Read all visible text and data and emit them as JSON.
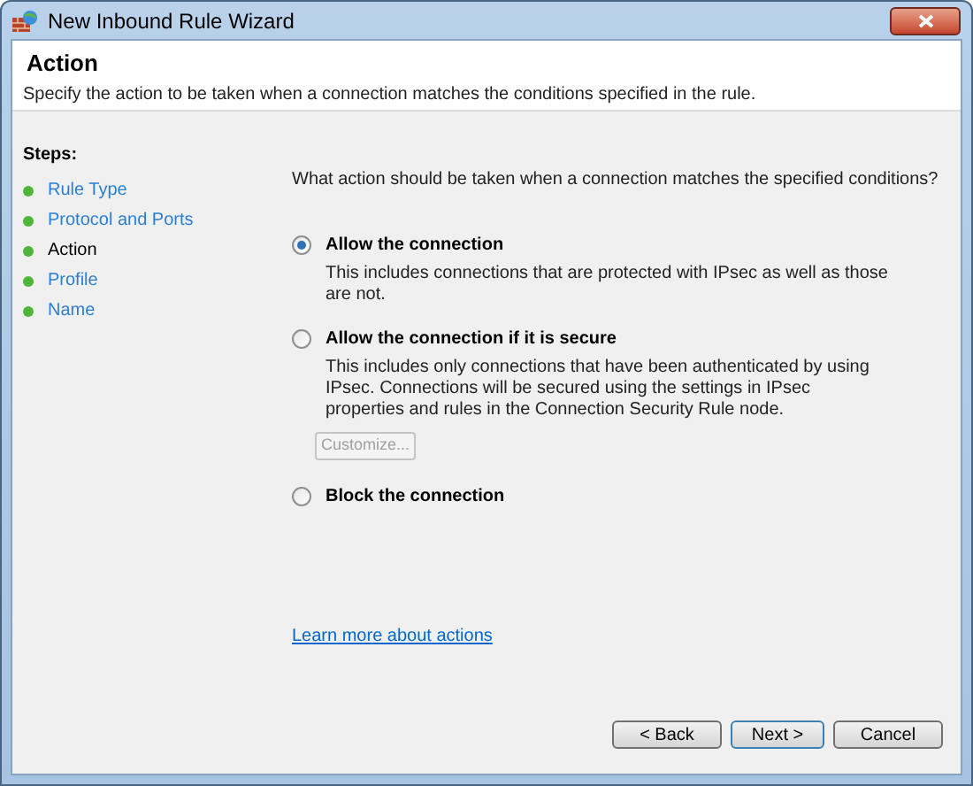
{
  "window": {
    "title": "New Inbound Rule Wizard"
  },
  "header": {
    "title": "Action",
    "description": "Specify the action to be taken when a connection matches the conditions specified in the rule."
  },
  "steps": {
    "heading": "Steps:",
    "items": [
      {
        "label": "Rule Type",
        "selected": false
      },
      {
        "label": "Protocol and Ports",
        "selected": false
      },
      {
        "label": "Action",
        "selected": true
      },
      {
        "label": "Profile",
        "selected": false
      },
      {
        "label": "Name",
        "selected": false
      }
    ]
  },
  "question": "What action should be taken when a connection matches the specified conditions?",
  "options": [
    {
      "label": "Allow the connection",
      "description": "This includes connections that are protected with IPsec as well as those are not.",
      "selected": true
    },
    {
      "label": "Allow the connection if it is secure",
      "description": "This includes only connections that have been authenticated by using IPsec.  Connections will be secured using the settings in IPsec properties and rules in the Connection Security Rule node.",
      "selected": false,
      "button": {
        "label": "Customize...",
        "disabled": true
      }
    },
    {
      "label": "Block the connection",
      "selected": false
    }
  ],
  "link": "Learn more about actions",
  "buttons": [
    {
      "label": "< Back",
      "default": false
    },
    {
      "label": "Next >",
      "default": true
    },
    {
      "label": "Cancel",
      "default": false
    }
  ]
}
